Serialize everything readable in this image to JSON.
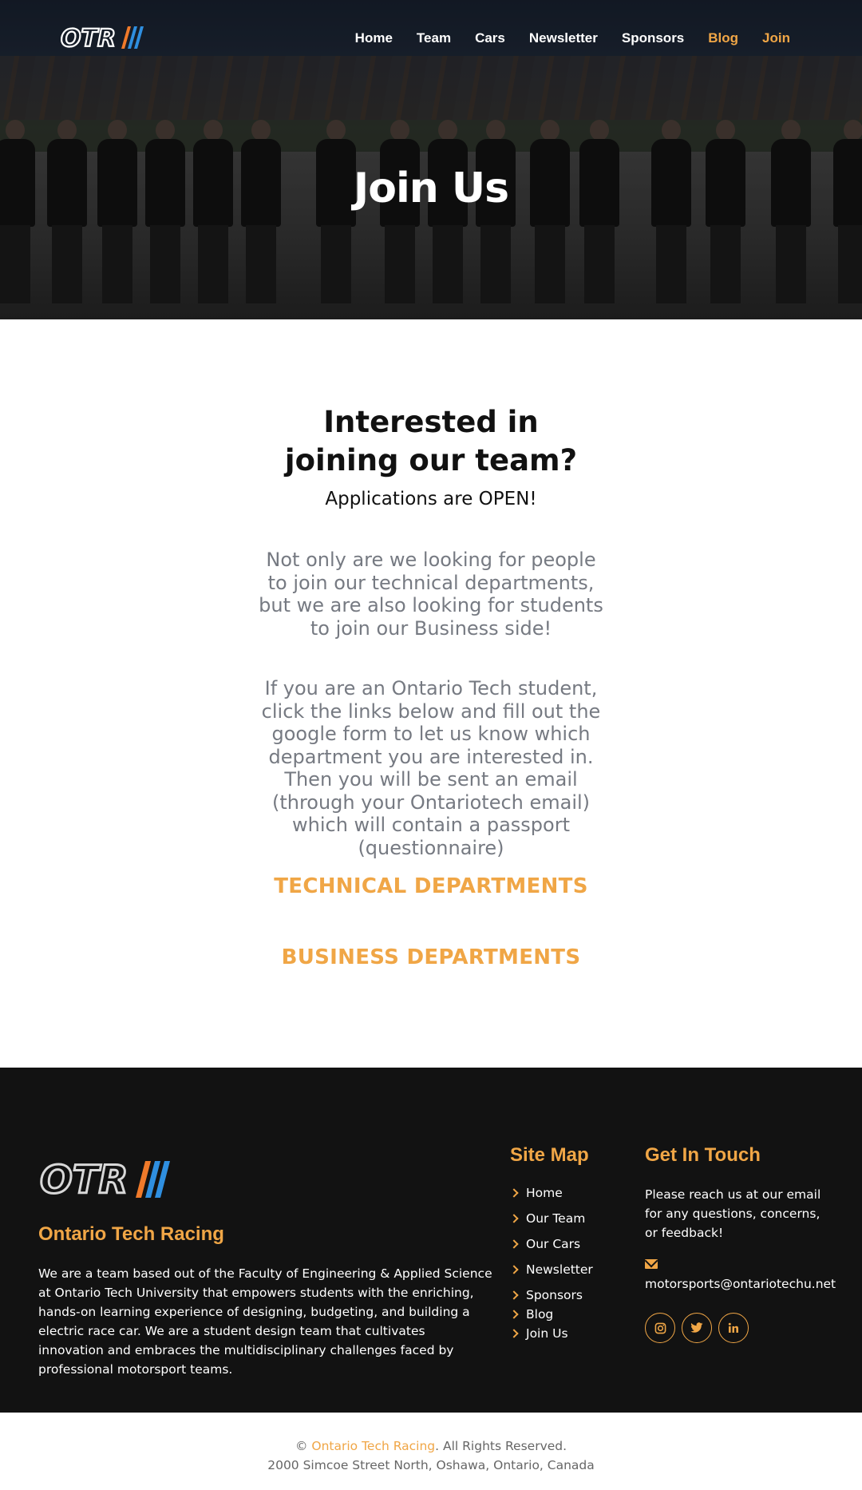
{
  "nav": {
    "items": [
      {
        "label": "Home"
      },
      {
        "label": "Team"
      },
      {
        "label": "Cars"
      },
      {
        "label": "Newsletter"
      },
      {
        "label": "Sponsors"
      },
      {
        "label": "Blog"
      },
      {
        "label": "Join"
      }
    ]
  },
  "hero": {
    "title": "Join Us"
  },
  "main": {
    "heading": "Interested in joining our team?",
    "subheading": "Applications are OPEN!",
    "paragraph1": "Not only are we looking for people to join our technical departments, but we are also looking for students to join our Business side!",
    "paragraph2": "If you are an Ontario Tech student, click the links below and fill out the google form to let us know which department you are interested in. Then you will be sent an email (through your Ontariotech email) which will contain a passport (questionnaire)",
    "technical_link": "TECHNICAL DEPARTMENTS",
    "business_link": "BUSINESS DEPARTMENTS"
  },
  "footer": {
    "brand": "Ontario Tech Racing",
    "description": "We are a team based out of the Faculty of Engineering & Applied Science at Ontario Tech University that empowers students with the enriching, hands-on learning experience of designing, budgeting, and building a electric race car. We are a student design team that cultivates innovation and embraces the multidisciplinary challenges faced by professional motorsport teams.",
    "sitemap_title": "Site Map",
    "sitemap": [
      {
        "label": "Home"
      },
      {
        "label": "Our Team"
      },
      {
        "label": "Our Cars"
      },
      {
        "label": "Newsletter"
      },
      {
        "label": "Sponsors"
      },
      {
        "label": "Blog"
      },
      {
        "label": "Join Us"
      }
    ],
    "contact_title": "Get In Touch",
    "contact_text": "Please reach us at our email for any questions, concerns, or feedback!",
    "email": "motorsports@ontariotechu.net",
    "socials": [
      {
        "icon": "instagram-icon"
      },
      {
        "icon": "twitter-icon"
      },
      {
        "icon": "linkedin-icon"
      }
    ]
  },
  "copyright": {
    "symbol": "©",
    "org": "Ontario Tech Racing",
    "rights": ". All Rights Reserved.",
    "address": "2000 Simcoe Street North, Oshawa, Ontario, Canada"
  },
  "colors": {
    "accent": "#f0a646",
    "footer_bg": "#121212",
    "paragraph": "#767a82"
  }
}
